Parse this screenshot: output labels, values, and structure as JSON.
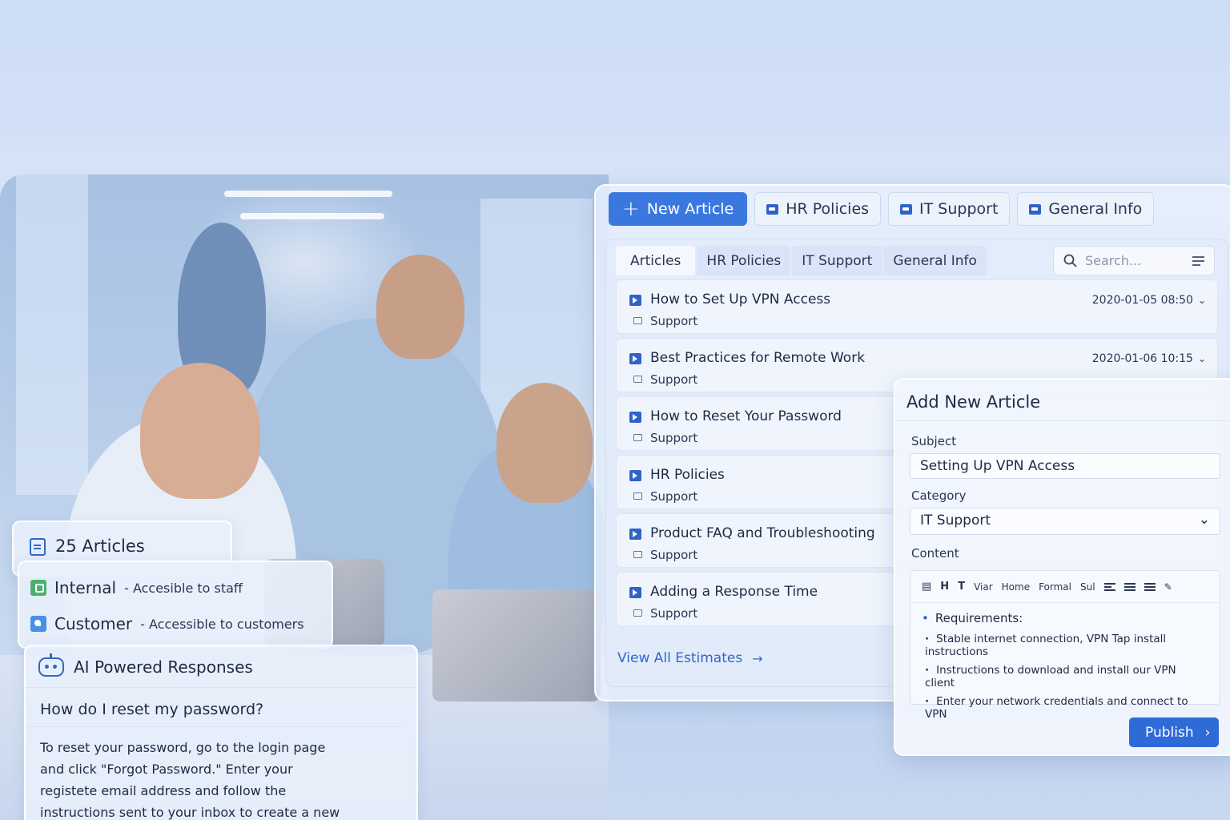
{
  "top_tabs": {
    "new_article": "New Article",
    "hr_policies": "HR Policies",
    "it_support": "IT Support",
    "general_info": "General Info"
  },
  "sub_tabs": [
    "Articles",
    "HR Policies",
    "IT Support",
    "General Info"
  ],
  "search": {
    "placeholder": "Search..."
  },
  "articles": [
    {
      "title": "How to Set Up VPN Access",
      "category": "Support",
      "date": "2020-01-05 08:50"
    },
    {
      "title": "Best Practices for Remote Work",
      "category": "Support",
      "date": "2020-01-06 10:15"
    },
    {
      "title": "How to Reset Your Password",
      "category": "Support"
    },
    {
      "title": "HR Policies",
      "category": "Support"
    },
    {
      "title": "Product FAQ and Troubleshooting",
      "category": "Support"
    },
    {
      "title": "Adding a Response Time",
      "category": "Support"
    }
  ],
  "view_all": "View All Estimates",
  "add_article": {
    "title": "Add New Article",
    "subject_label": "Subject",
    "subject_value": "Setting Up VPN Access",
    "category_label": "Category",
    "category_value": "IT Support",
    "content_label": "Content",
    "toolbar": [
      "Viar",
      "Home",
      "Formal",
      "Sul"
    ],
    "requirements_heading": "Requirements:",
    "requirements": [
      "Stable internet connection, VPN Tap install instructions",
      "Instructions to download and install our VPN client",
      "Enter your network credentials and connect to VPN"
    ],
    "publish": "Publish"
  },
  "count_card": {
    "text": "25 Articles"
  },
  "access": {
    "internal_name": "Internal",
    "internal_desc": "- Accesible to staff",
    "customer_name": "Customer",
    "customer_desc": "- Accessible to customers"
  },
  "ai": {
    "title": "AI Powered Responses",
    "question": "How do I reset my password?",
    "answer": "To reset your password, go to the login page and click \"Forgot Password.\" Enter your registete email address and follow the instructions sent to your inbox to create a new password."
  },
  "colors": {
    "accent": "#3a78e0",
    "publish": "#2f6ad9",
    "green": "#4bb06e"
  }
}
